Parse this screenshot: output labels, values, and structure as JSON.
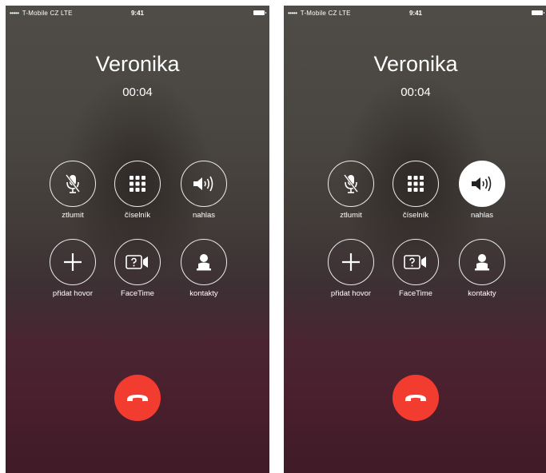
{
  "screens": [
    {
      "status": {
        "dots": "•••••",
        "carrier": "T-Mobile CZ",
        "network": "LTE",
        "time": "9:41"
      },
      "caller_name": "Veronika",
      "call_duration": "00:04",
      "controls": [
        {
          "label": "ztlumit",
          "icon": "microphone-muted-icon",
          "active": false
        },
        {
          "label": "číselník",
          "icon": "keypad-icon",
          "active": false
        },
        {
          "label": "nahlas",
          "icon": "speaker-icon",
          "active": false
        },
        {
          "label": "přidat hovor",
          "icon": "plus-icon",
          "active": false
        },
        {
          "label": "FaceTime",
          "icon": "facetime-icon",
          "active": false
        },
        {
          "label": "kontakty",
          "icon": "contacts-icon",
          "active": false
        }
      ]
    },
    {
      "status": {
        "dots": "•••••",
        "carrier": "T-Mobile CZ",
        "network": "LTE",
        "time": "9:41"
      },
      "caller_name": "Veronika",
      "call_duration": "00:04",
      "controls": [
        {
          "label": "ztlumit",
          "icon": "microphone-muted-icon",
          "active": false
        },
        {
          "label": "číselník",
          "icon": "keypad-icon",
          "active": false
        },
        {
          "label": "nahlas",
          "icon": "speaker-icon",
          "active": true
        },
        {
          "label": "přidat hovor",
          "icon": "plus-icon",
          "active": false
        },
        {
          "label": "FaceTime",
          "icon": "facetime-icon",
          "active": false
        },
        {
          "label": "kontakty",
          "icon": "contacts-icon",
          "active": false
        }
      ]
    }
  ],
  "colors": {
    "end_call": "#f23c30",
    "active_button": "#ffffff",
    "text": "#ffffff"
  }
}
